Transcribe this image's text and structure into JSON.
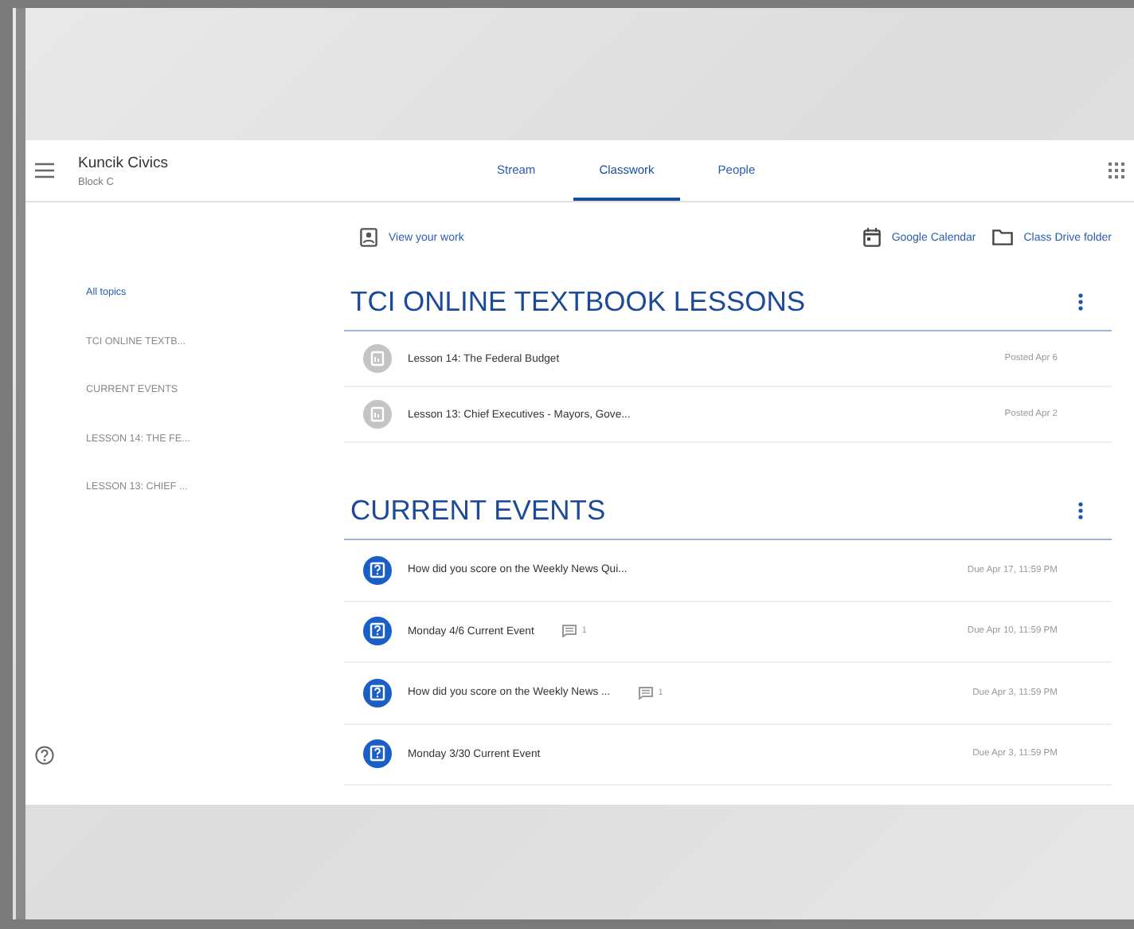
{
  "header": {
    "class_name": "Kuncik Civics",
    "class_section": "Block C"
  },
  "tabs": [
    {
      "label": "Stream",
      "selected": false
    },
    {
      "label": "Classwork",
      "selected": true
    },
    {
      "label": "People",
      "selected": false
    }
  ],
  "toolbar": {
    "view_work": "View your work",
    "links": [
      {
        "kind": "calendar",
        "label": "Google Calendar"
      },
      {
        "kind": "folder",
        "label": "Class Drive folder"
      }
    ]
  },
  "topics": [
    {
      "label": "All topics",
      "selected": true
    },
    {
      "label": "TCI ONLINE TEXTB...",
      "selected": false
    },
    {
      "label": "CURRENT EVENTS",
      "selected": false
    },
    {
      "label": "LESSON 14: THE FE...",
      "selected": false
    },
    {
      "label": "LESSON 13: CHIEF ...",
      "selected": false
    }
  ],
  "sections": [
    {
      "title": "TCI ONLINE TEXTBOOK LESSONS",
      "items": [
        {
          "kind": "material",
          "title": "Lesson 14: The Federal Budget",
          "date": "Posted Apr 6"
        },
        {
          "kind": "material",
          "title": "Lesson 13: Chief Executives - Mayors, Gove...",
          "date": "Posted Apr 2"
        }
      ]
    },
    {
      "title": "CURRENT EVENTS",
      "items": [
        {
          "kind": "assignment",
          "title": "How did you score on the Weekly News Qui...",
          "date": "Due Apr 17, 11:59 PM"
        },
        {
          "kind": "assignment",
          "title": "Monday 4/6 Current Event",
          "comments": "1",
          "date": "Due Apr 10, 11:59 PM"
        },
        {
          "kind": "assignment",
          "title": "How did you score on the Weekly News ...",
          "comments": "1",
          "date": "Due Apr 3, 11:59 PM"
        },
        {
          "kind": "assignment",
          "title": "Monday 3/30 Current Event",
          "date": "Due Apr 3, 11:59 PM"
        }
      ]
    }
  ]
}
